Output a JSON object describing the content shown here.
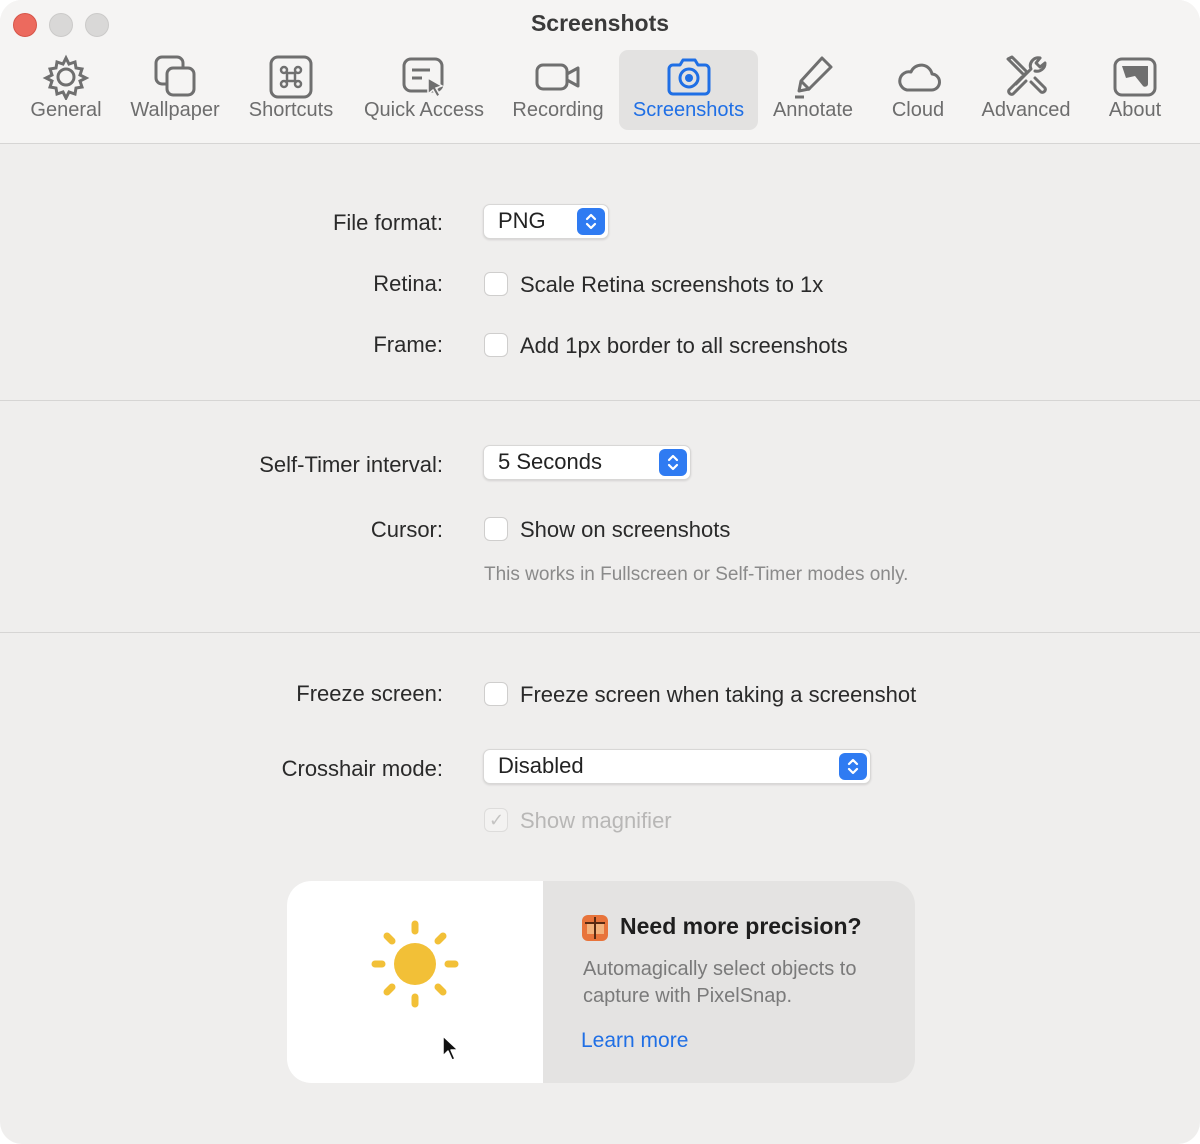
{
  "window": {
    "title": "Screenshots"
  },
  "toolbar": {
    "tabs": [
      {
        "label": "General",
        "icon": "gear-icon"
      },
      {
        "label": "Wallpaper",
        "icon": "wallpaper-icon"
      },
      {
        "label": "Shortcuts",
        "icon": "command-key-icon"
      },
      {
        "label": "Quick Access",
        "icon": "quick-access-icon"
      },
      {
        "label": "Recording",
        "icon": "video-camera-icon"
      },
      {
        "label": "Screenshots",
        "icon": "camera-icon",
        "selected": true
      },
      {
        "label": "Annotate",
        "icon": "pencil-icon"
      },
      {
        "label": "Cloud",
        "icon": "cloud-icon"
      },
      {
        "label": "Advanced",
        "icon": "tools-icon"
      },
      {
        "label": "About",
        "icon": "about-icon"
      }
    ]
  },
  "section1": {
    "file_format_label": "File format:",
    "file_format_value": "PNG",
    "retina_label": "Retina:",
    "retina_text": "Scale Retina screenshots to 1x",
    "retina_checked": false,
    "frame_label": "Frame:",
    "frame_text": "Add 1px border to all screenshots",
    "frame_checked": false
  },
  "section2": {
    "timer_label": "Self-Timer interval:",
    "timer_value": "5 Seconds",
    "cursor_label": "Cursor:",
    "cursor_text": "Show on screenshots",
    "cursor_checked": false,
    "hint": "This works in Fullscreen or Self-Timer modes only."
  },
  "section3": {
    "freeze_label": "Freeze screen:",
    "freeze_text": "Freeze screen when taking a screenshot",
    "freeze_checked": false,
    "crosshair_label": "Crosshair mode:",
    "crosshair_value": "Disabled",
    "magnifier_text": "Show magnifier",
    "magnifier_checked": true,
    "magnifier_disabled": true
  },
  "promo": {
    "title": "Need more precision?",
    "text": "Automagically select objects to capture with PixelSnap.",
    "link": "Learn more"
  },
  "colors": {
    "accent": "#1f6fe5",
    "close": "#ec6a5e",
    "sun": "#f2c037"
  }
}
